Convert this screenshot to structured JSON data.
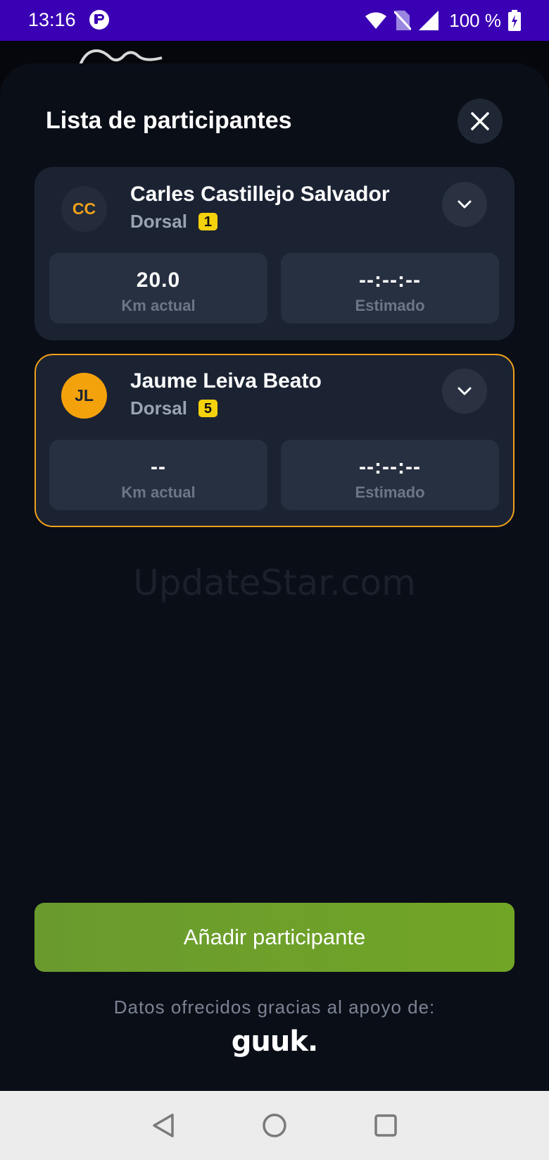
{
  "status_bar": {
    "time": "13:16",
    "battery": "100 %"
  },
  "sheet": {
    "title": "Lista de participantes",
    "close_icon": "close-icon"
  },
  "participants": [
    {
      "initials": "CC",
      "name": "Carles Castillejo Salvador",
      "dorsal_label": "Dorsal",
      "dorsal": "1",
      "km_value": "20.0",
      "km_label": "Km actual",
      "estimate_value": "--:--:--",
      "estimate_label": "Estimado",
      "highlighted": false
    },
    {
      "initials": "JL",
      "name": "Jaume Leiva Beato",
      "dorsal_label": "Dorsal",
      "dorsal": "5",
      "km_value": "--",
      "km_label": "Km actual",
      "estimate_value": "--:--:--",
      "estimate_label": "Estimado",
      "highlighted": true
    }
  ],
  "watermark": "UpdateStar.com",
  "actions": {
    "add_label": "Añadir participante"
  },
  "footer": {
    "sponsor_text": "Datos ofrecidos gracias al apoyo de:",
    "sponsor_logo": "guuk."
  },
  "colors": {
    "status_bar": "#3a00b4",
    "sheet": "#0a0e17",
    "card": "#1b2333",
    "accent": "#f0a019",
    "badge": "#f4d20c",
    "button": "#6a9a2e"
  }
}
